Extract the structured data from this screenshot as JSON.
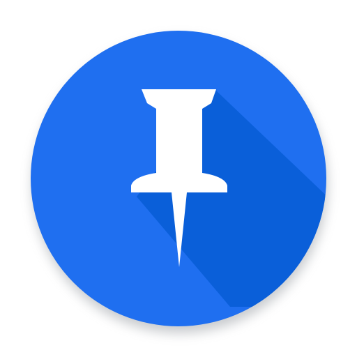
{
  "app_icon": {
    "icon": "pushpin-icon",
    "colors": {
      "background": "#ffffff",
      "circle": "#1f6ff0",
      "long_shadow": "#0a5fd9",
      "glyph": "#ffffff",
      "drop_shadow": "#9ea3a8"
    }
  }
}
